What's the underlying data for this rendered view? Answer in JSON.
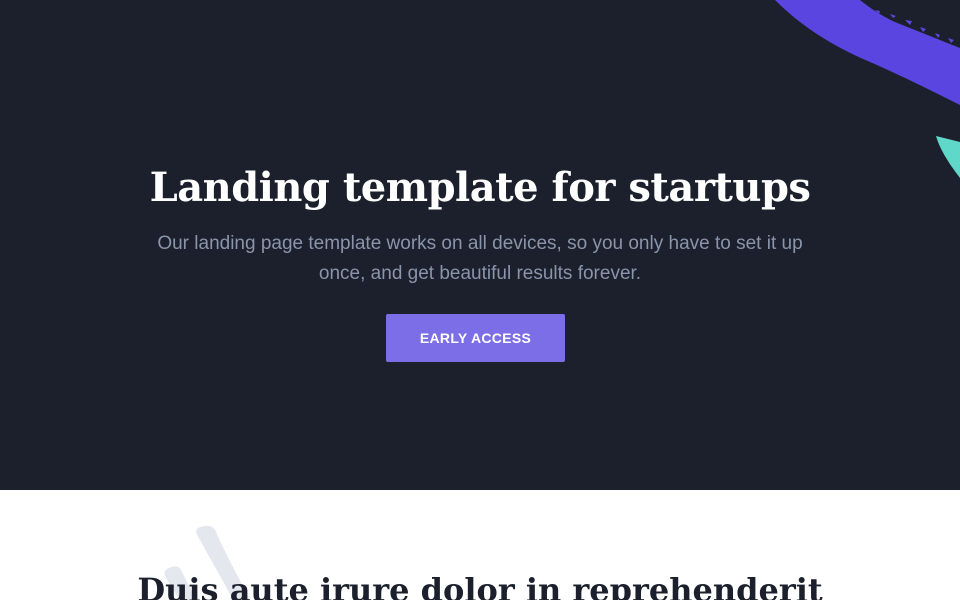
{
  "hero": {
    "title": "Landing template for startups",
    "description": "Our landing page template works on all devices, so you only have to set it up once, and get beautiful results forever.",
    "cta_label": "EARLY ACCESS"
  },
  "features": {
    "title": "Duis aute irure dolor in reprehenderit"
  },
  "colors": {
    "hero_background": "#1b202c",
    "accent": "#7b6ee6",
    "brush_purple": "#5a45e0",
    "brush_teal": "#5fd8c9",
    "muted_text": "#8a94ab",
    "brush_gray": "#e4e7ee"
  },
  "icons": {
    "hero_decoration": "brush-stroke-decoration",
    "section_decoration": "brush-stroke-decoration"
  }
}
